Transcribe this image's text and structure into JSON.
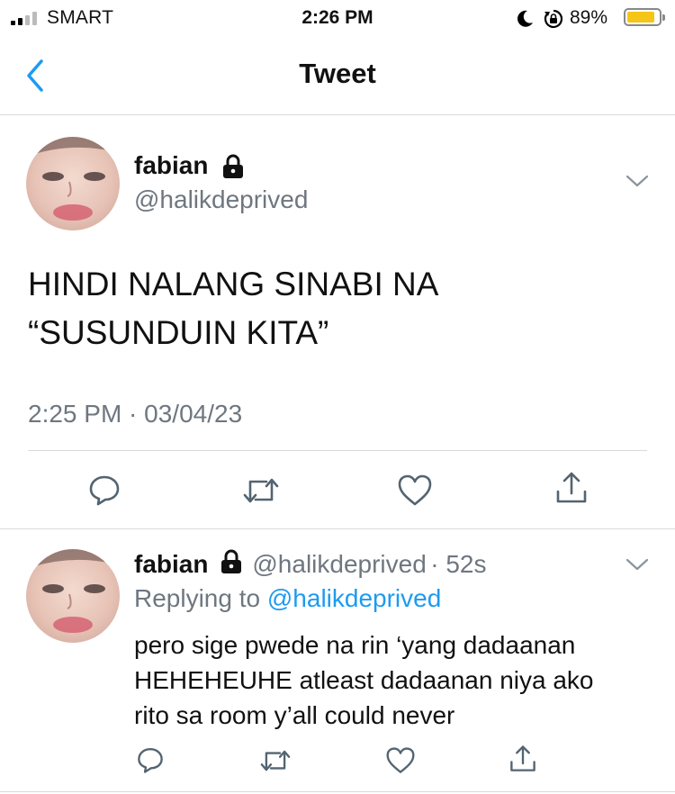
{
  "status_bar": {
    "carrier": "SMART",
    "time": "2:26 PM",
    "battery_text": "89%",
    "battery_level": 0.89,
    "icons": [
      "signal-icon",
      "moon-icon",
      "rotation-lock-icon",
      "battery-icon"
    ]
  },
  "nav": {
    "title": "Tweet",
    "back_icon": "chevron-left-icon"
  },
  "main_tweet": {
    "display_name": "fabian",
    "handle": "@halikdeprived",
    "text_line1": "HINDI NALANG SINABI NA",
    "text_line2": "“SUSUNDUIN KITA”",
    "timestamp": "2:25 PM · 03/04/23",
    "actions": [
      "reply-icon",
      "retweet-icon",
      "like-icon",
      "share-icon"
    ]
  },
  "reply_tweet": {
    "display_name": "fabian",
    "handle": "@halikdeprived",
    "time_ago": "· 52s",
    "replying_prefix": "Replying to",
    "replying_handle": "@halikdeprived",
    "text_line1": "pero sige pwede na rin ‘yang dadaanan",
    "text_line2": "HEHEHEUHE atleast dadaanan niya ako",
    "text_line3": "rito sa room y’all could never",
    "actions": [
      "reply-icon",
      "retweet-icon",
      "like-icon",
      "share-icon"
    ]
  },
  "colors": {
    "accent": "#1d9bf0",
    "muted": "#6e7780",
    "battery": "#f5c518"
  }
}
